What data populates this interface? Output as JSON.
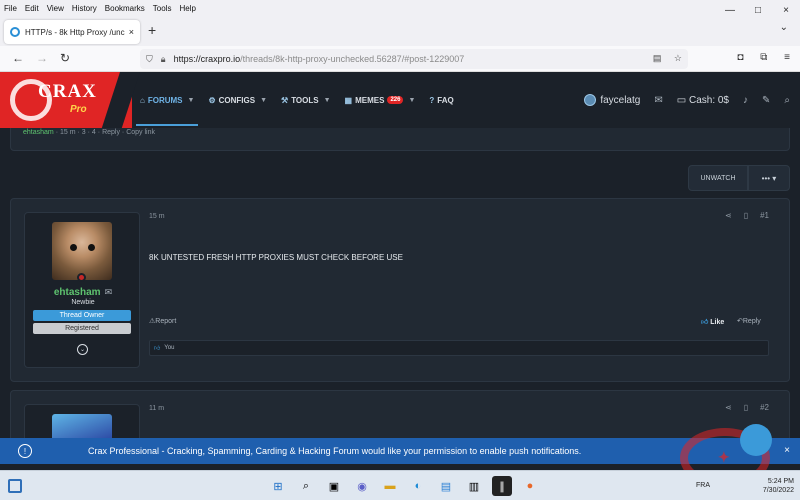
{
  "browser": {
    "menu": [
      "File",
      "Edit",
      "View",
      "History",
      "Bookmarks",
      "Tools",
      "Help"
    ],
    "tab_title": "HTTP/s - 8k Http Proxy /unche",
    "tab_close": "×",
    "new_tab": "+",
    "url_host": "https://craxpro.io",
    "url_path": "/threads/8k-http-proxy-unchecked.56287/#post-1229007",
    "win_min": "—",
    "win_max": "□",
    "win_close": "×"
  },
  "site": {
    "logo_text": "CRAX",
    "logo_sub": "Pro",
    "nav": [
      {
        "label": "FORUMS",
        "icon": "forums-icon"
      },
      {
        "label": "CONFIGS",
        "icon": "configs-icon"
      },
      {
        "label": "TOOLS",
        "icon": "tools-icon"
      },
      {
        "label": "MEMES",
        "icon": "memes-icon",
        "badge": "226"
      },
      {
        "label": "FAQ",
        "icon": "faq-icon"
      }
    ],
    "username": "faycelatg",
    "cash": "Cash: 0$"
  },
  "prev_post": {
    "user": "ehtasham",
    "time": "15 m",
    "replies": "3",
    "views": "4",
    "reply": "Reply",
    "copy": "Copy link"
  },
  "thread_controls": {
    "unwatch": "UNWATCH",
    "more": "•••"
  },
  "post1": {
    "username": "ehtasham",
    "user_title": "Newbie",
    "badge_owner": "Thread Owner",
    "badge_registered": "Registered",
    "time": "15 m",
    "number": "#1",
    "body": "8K UNTESTED FRESH HTTP PROXIES MUST CHECK BEFORE USE",
    "report": "Report",
    "like": "Like",
    "reply": "Reply",
    "reactions": "You"
  },
  "post2": {
    "time": "11 m",
    "number": "#2"
  },
  "notification": {
    "text": "Crax Professional - Cracking, Spamming, Carding & Hacking Forum would like your permission to enable push notifications.",
    "close": "×"
  },
  "taskbar": {
    "lang": "FRA",
    "time": "5:24 PM",
    "date": "7/30/2022"
  }
}
